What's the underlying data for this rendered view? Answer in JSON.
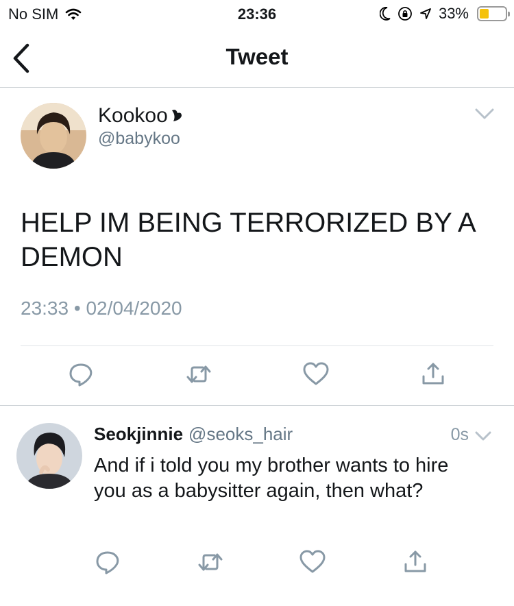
{
  "status_bar": {
    "carrier": "No SIM",
    "time": "23:36",
    "battery_percent": "33%",
    "battery_level": 0.33,
    "icons": [
      "wifi-icon",
      "moon-icon",
      "rotation-lock-icon",
      "location-icon",
      "battery-icon"
    ]
  },
  "nav": {
    "title": "Tweet",
    "back_icon": "chevron-left-icon"
  },
  "tweet": {
    "author_name": "Kookoo",
    "author_handle": "@babykoo",
    "text": "HELP IM BEING TERRORIZED BY A DEMON",
    "time": "23:33",
    "separator": "•",
    "date": "02/04/2020",
    "actions": [
      "reply-icon",
      "retweet-icon",
      "like-icon",
      "share-icon"
    ]
  },
  "reply": {
    "author_name": "Seokjinnie",
    "author_handle": "@seoks_hair",
    "time": "0s",
    "text": "And if i told you my brother wants to hire you as a babysitter again, then what?",
    "actions": [
      "reply-icon",
      "retweet-icon",
      "like-icon",
      "share-icon"
    ]
  },
  "colors": {
    "text_primary": "#14171a",
    "text_secondary": "#657786",
    "icon_gray": "#8899a6",
    "divider": "#cfd4d8",
    "battery": "#f5c20c"
  }
}
